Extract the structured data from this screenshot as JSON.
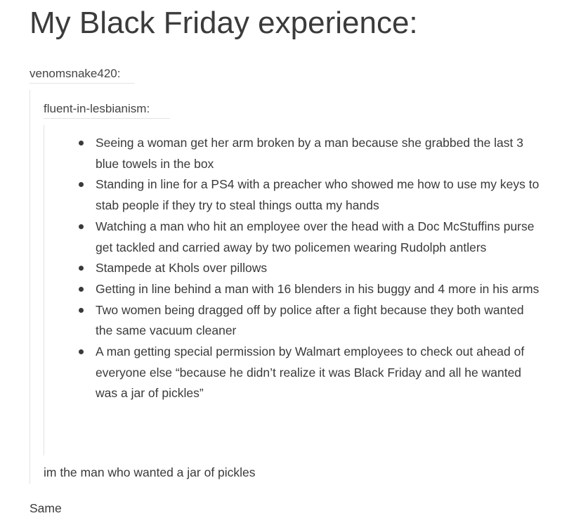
{
  "title": "My Black Friday experience:",
  "post": {
    "user1": "venomsnake420:",
    "user2": "fluent-in-lesbianism:",
    "items": [
      "Seeing a woman get her arm broken by a man because she grabbed the last 3 blue towels in the box",
      "Standing in line for a PS4 with a preacher who showed me how to use my keys to stab people if they try to steal things outta my hands",
      "Watching a man who hit an employee over the head with a Doc McStuffins purse get tackled and carried away by two policemen wearing Rudolph antlers",
      "Stampede at Khols over pillows",
      "Getting in line behind a man with 16 blenders in his buggy and 4 more in his arms",
      "Two women being dragged off by police after a fight because they both wanted the same vacuum cleaner",
      "A man getting special permission by Walmart employees to check out ahead of everyone else “because he didn’t realize it was Black Friday and all he wanted was a jar of pickles”"
    ],
    "reply1": "im the man who wanted a jar of pickles",
    "reply2": "Same"
  }
}
